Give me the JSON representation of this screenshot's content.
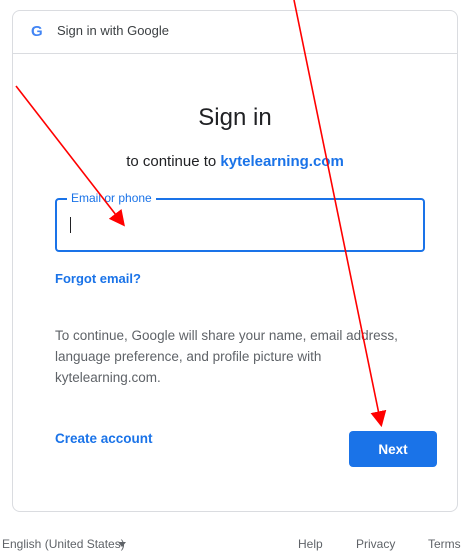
{
  "header": {
    "title": "Sign in with Google"
  },
  "main": {
    "title": "Sign in",
    "subtitle_prefix": "to continue to ",
    "subtitle_app": "kytelearning.com",
    "email_label": "Email or phone",
    "email_value": "",
    "forgot_label": "Forgot email?",
    "info_text": "To continue, Google will share your name, email address, language preference, and profile picture with kytelearning.com.",
    "create_account_label": "Create account",
    "next_label": "Next"
  },
  "footer": {
    "language": "English (United States)",
    "help": "Help",
    "privacy": "Privacy",
    "terms": "Terms"
  },
  "colors": {
    "accent": "#1a73e8",
    "annotation": "#ff0000"
  }
}
